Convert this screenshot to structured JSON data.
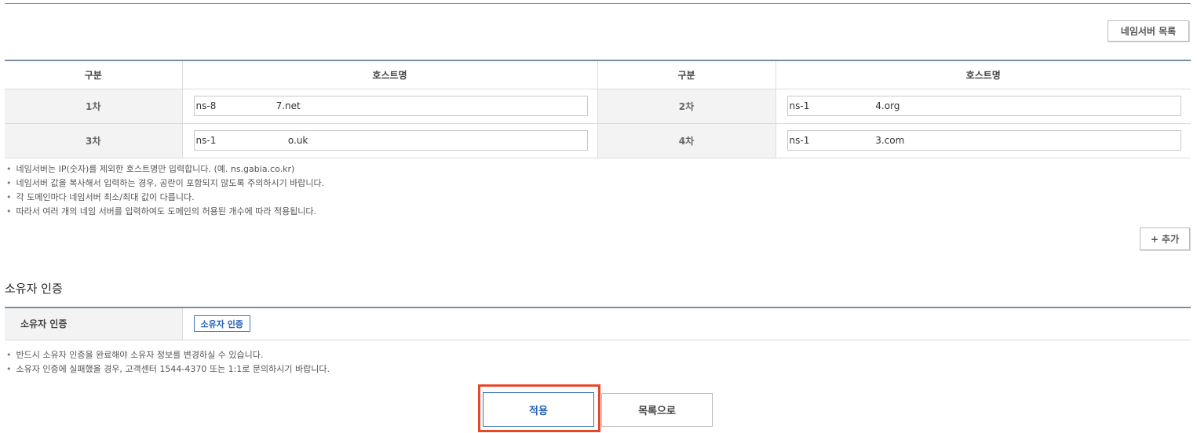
{
  "nameserver": {
    "list_button": "네임서버 목록",
    "headers": {
      "category": "구분",
      "hostname": "호스트명"
    },
    "rows": [
      {
        "left_label": "1차",
        "left_value": "ns-8                    7.net",
        "right_label": "2차",
        "right_value": "ns-1                      4.org"
      },
      {
        "left_label": "3차",
        "left_value": "ns-1                        o.uk",
        "right_label": "4차",
        "right_value": "ns-1                      3.com"
      }
    ],
    "notes": [
      "네임서버는 IP(숫자)를 제외한 호스트명만 입력합니다. (예. ns.gabia.co.kr)",
      "네임서버 값을 복사해서 입력하는 경우, 공란이 포함되지 않도록 주의하시기 바랍니다.",
      "각 도메인마다 네임서버 최소/최대 값이 다릅니다.",
      "따라서 여러 개의 네임 서버를 입력하여도 도메인의 허용된 개수에 따라 적용됩니다."
    ],
    "add_button": "+ 추가"
  },
  "owner_verification": {
    "section_title": "소유자 인증",
    "row_label": "소유자 인증",
    "verify_button": "소유자 인증",
    "notes": [
      "반드시 소유자 인증을 완료해야 소유자 정보를 변경하실 수 있습니다.",
      "소유자 인증에 실패했을 경우, 고객센터 1544-4370 또는 1:1로 문의하시기 바랍니다."
    ]
  },
  "actions": {
    "apply": "적용",
    "back_to_list": "목록으로"
  },
  "colors": {
    "table_top_border": "#788fa3",
    "primary_blue": "#2a62b8",
    "highlight": "#e8472a"
  }
}
